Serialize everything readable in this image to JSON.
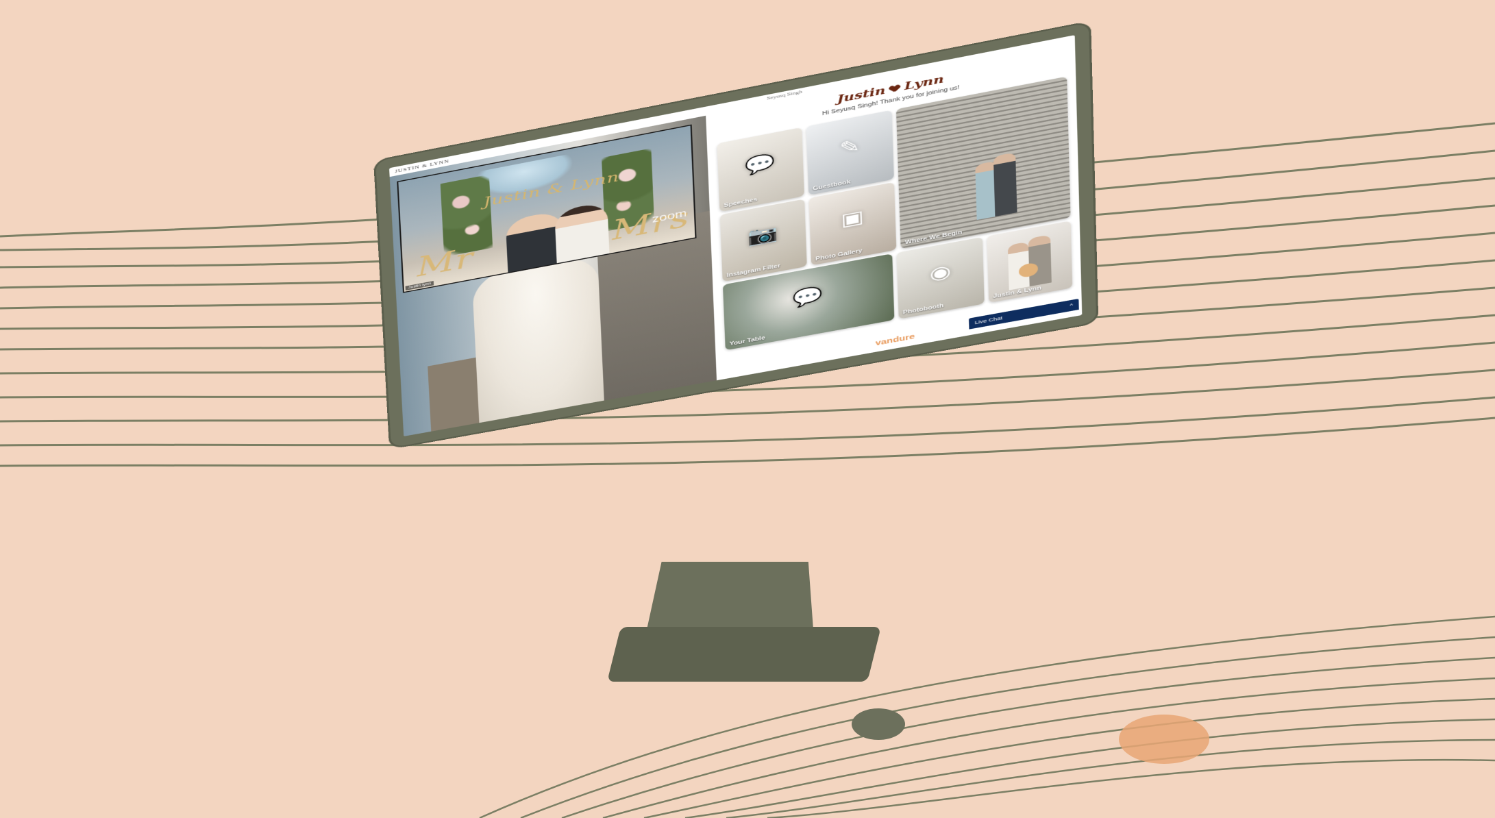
{
  "video": {
    "header": "JUSTIN & LYNN",
    "backdrop_title": "Justin & Lynn",
    "sign_left": "Mr",
    "sign_right": "Mrs",
    "watermark": "zoom",
    "participant": "Justin lynn"
  },
  "portal": {
    "user_name": "Seyusq Singh",
    "brand_left": "Justin",
    "brand_right": "Lynn",
    "welcome": "Hi Seyusq Singh! Thank you for joining us!",
    "tiles": [
      {
        "label": "Speeches",
        "icon": "speech-bubble-icon"
      },
      {
        "label": "Guestbook",
        "icon": "pen-book-icon"
      },
      {
        "label": "Where We Begin",
        "icon": ""
      },
      {
        "label": "Instagram Filter",
        "icon": "camera-icon"
      },
      {
        "label": "Photo Gallery",
        "icon": "photo-icon"
      },
      {
        "label": "Your Table",
        "icon": "chat-bubbles-icon"
      },
      {
        "label": "Photobooth",
        "icon": "photobooth-icon"
      },
      {
        "label": "Justin & Lynn",
        "icon": ""
      }
    ],
    "footer_logo": "vandure",
    "live_chat": {
      "label": "Live Chat",
      "toggle": "^"
    }
  },
  "colors": {
    "background": "#f3d5c0",
    "monitor": "#6c705c",
    "brand": "#6b2712",
    "accent": "#e89a5c",
    "chat_bar": "#0e2d5f"
  }
}
